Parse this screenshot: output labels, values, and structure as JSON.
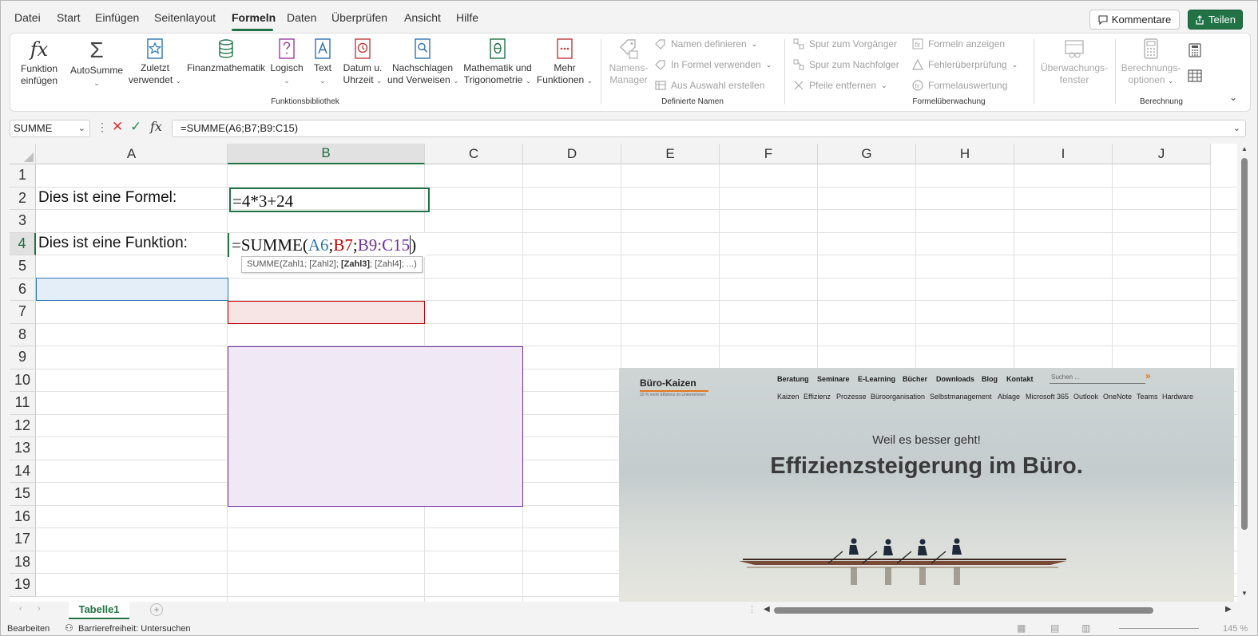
{
  "menu": [
    "Datei",
    "Start",
    "Einfügen",
    "Seitenlayout",
    "Formeln",
    "Daten",
    "Überprüfen",
    "Ansicht",
    "Hilfe"
  ],
  "topbar": {
    "comment": "Kommentare",
    "share": "Teilen"
  },
  "ribbon": {
    "insert_function": [
      "Funktion",
      "einfügen"
    ],
    "autosum": "AutoSumme",
    "recent": [
      "Zuletzt",
      "verwendet"
    ],
    "financial": "Finanzmathematik",
    "logical": "Logisch",
    "text": "Text",
    "datetime": [
      "Datum u.",
      "Uhrzeit"
    ],
    "lookup": [
      "Nachschlagen",
      "und Verweisen"
    ],
    "math": [
      "Mathematik und",
      "Trigonometrie"
    ],
    "more": [
      "Mehr",
      "Funktionen"
    ],
    "group_library": "Funktionsbibliothek",
    "name_manager": [
      "Namens-",
      "Manager"
    ],
    "define_name": "Namen definieren",
    "use_in_formula": "In Formel verwenden",
    "create_from_selection": "Aus Auswahl erstellen",
    "group_names": "Definierte Namen",
    "trace_precedents": "Spur zum Vorgänger",
    "trace_dependents": "Spur zum Nachfolger",
    "remove_arrows": "Pfeile entfernen",
    "show_formulas": "Formeln anzeigen",
    "error_checking": "Fehlerüberprüfung",
    "evaluate_formula": "Formelauswertung",
    "watch_window": [
      "Überwachungs-",
      "fenster"
    ],
    "group_auditing": "Formelüberwachung",
    "calc_options": [
      "Berechnungs-",
      "optionen"
    ],
    "group_calc": "Berechnung"
  },
  "formula_bar": {
    "namebox": "SUMME",
    "fx": "fx",
    "formula": "=SUMME(A6;B7;B9:C15)"
  },
  "columns": [
    "A",
    "B",
    "C",
    "D",
    "E",
    "F",
    "G",
    "H",
    "I",
    "J"
  ],
  "rows": [
    "1",
    "2",
    "3",
    "4",
    "5",
    "6",
    "7",
    "8",
    "9",
    "10",
    "11",
    "12",
    "13",
    "14",
    "15",
    "16",
    "17",
    "18",
    "19"
  ],
  "cells": {
    "a2": "Dies ist eine Formel:",
    "b2": "=4*3+24",
    "a4": "Dies ist eine Funktion:",
    "b4_parts": [
      "=SUMME(",
      "A6",
      ";",
      "B7",
      ";",
      "B9:C15",
      ")"
    ]
  },
  "tooltip": {
    "before": "SUMME(Zahl1; [Zahl2]; ",
    "bold": "[Zahl3]",
    "after": "; [Zahl4]; ...)"
  },
  "ref_colors": {
    "a6": "#2e75b6",
    "b7": "#c00000",
    "b9c15": "#7030a0"
  },
  "sheet_tab": "Tabelle1",
  "status": {
    "mode": "Bearbeiten",
    "accessibility": "Barrierefreiheit: Untersuchen",
    "zoom": "145 %"
  },
  "website": {
    "logo": "Büro-Kaizen",
    "tagline": "20 % mehr Effizienz im Unternehmen",
    "nav": [
      "Beratung",
      "Seminare",
      "E-Learning",
      "Bücher",
      "Downloads",
      "Blog",
      "Kontakt"
    ],
    "search": "Suchen ...",
    "subnav": [
      "Kaizen",
      "Effizienz",
      "Prozesse",
      "Büroorganisation",
      "Selbstmanagement",
      "Ablage",
      "Microsoft 365",
      "Outlook",
      "OneNote",
      "Teams",
      "Hardware"
    ],
    "kicker": "Weil es besser geht!",
    "headline": "Effizienzsteigerung im Büro."
  },
  "accent": "#217346"
}
